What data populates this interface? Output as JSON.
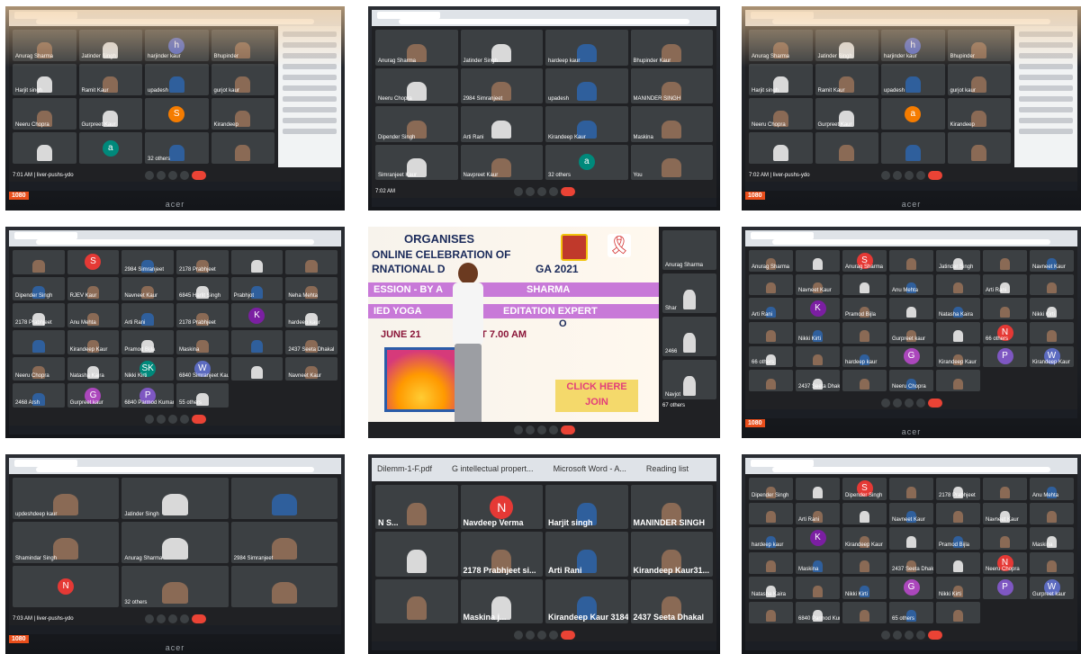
{
  "photos": [
    {
      "id": "p1",
      "meeting_time": "7:01 AM | liver-pushs-ydo",
      "tiles": [
        {
          "label": "Anurag Sharma",
          "kind": "video"
        },
        {
          "label": "Jatinder Singh",
          "kind": "video"
        },
        {
          "label": "harjinder kaur",
          "kind": "avatar",
          "letter": "h",
          "color": "#5c6bc0"
        },
        {
          "label": "Bhupinder",
          "kind": "video"
        },
        {
          "label": "Harjit singh",
          "kind": "video"
        },
        {
          "label": "Ramit Kaur",
          "kind": "video"
        },
        {
          "label": "upadesh",
          "kind": "video"
        },
        {
          "label": "gurjot kaur",
          "kind": "video"
        },
        {
          "label": "Neeru Chopra",
          "kind": "video"
        },
        {
          "label": "Gurpreet Kaur",
          "kind": "video"
        },
        {
          "label": "",
          "kind": "avatar",
          "letter": "S",
          "color": "#f57c00"
        },
        {
          "label": "Kirandeep",
          "kind": "video"
        },
        {
          "label": "",
          "kind": "video"
        },
        {
          "label": "",
          "kind": "avatar",
          "letter": "a",
          "color": "#00897b"
        },
        {
          "label": "32 others",
          "kind": "video"
        },
        {
          "label": "",
          "kind": "video"
        }
      ],
      "sidebar": true,
      "sticker": "1080",
      "brand": "acer"
    },
    {
      "id": "p2",
      "meeting_time": "7:02 AM",
      "tiles": [
        {
          "label": "Anurag Sharma",
          "kind": "video"
        },
        {
          "label": "Jatinder Singh",
          "kind": "video"
        },
        {
          "label": "hardeep kaur",
          "kind": "video"
        },
        {
          "label": "Bhupinder Kaur",
          "kind": "video"
        },
        {
          "label": "Neeru Chopra",
          "kind": "video"
        },
        {
          "label": "2984 Simranjeet",
          "kind": "video"
        },
        {
          "label": "upadesh",
          "kind": "video"
        },
        {
          "label": "MANINDER SINGH",
          "kind": "video"
        },
        {
          "label": "Dipender Singh",
          "kind": "video"
        },
        {
          "label": "Arti Rani",
          "kind": "video"
        },
        {
          "label": "Kirandeep Kaur",
          "kind": "video"
        },
        {
          "label": "Maskina",
          "kind": "video"
        },
        {
          "label": "Simranjeet Kaur",
          "kind": "video"
        },
        {
          "label": "Navpreet Kaur",
          "kind": "video"
        },
        {
          "label": "32 others",
          "kind": "avatar",
          "letter": "a",
          "color": "#00897b"
        },
        {
          "label": "You",
          "kind": "video"
        }
      ],
      "sidebar": false,
      "sticker": "",
      "brand": ""
    },
    {
      "id": "p3",
      "meeting_time": "7:02 AM | liver-pushs-ydo",
      "tiles": [
        {
          "label": "Anurag Sharma",
          "kind": "video"
        },
        {
          "label": "Jatinder Singh",
          "kind": "video"
        },
        {
          "label": "harjinder kaur",
          "kind": "avatar",
          "letter": "h",
          "color": "#5c6bc0"
        },
        {
          "label": "Bhupinder",
          "kind": "video"
        },
        {
          "label": "Harjit singh",
          "kind": "video"
        },
        {
          "label": "Ramit Kaur",
          "kind": "video"
        },
        {
          "label": "upadesh",
          "kind": "video"
        },
        {
          "label": "gurjot kaur",
          "kind": "video"
        },
        {
          "label": "Neeru Chopra",
          "kind": "video"
        },
        {
          "label": "Gurpreet Kaur",
          "kind": "video"
        },
        {
          "label": "",
          "kind": "avatar",
          "letter": "a",
          "color": "#f57c00"
        },
        {
          "label": "Kirandeep",
          "kind": "video"
        },
        {
          "label": "",
          "kind": "video"
        },
        {
          "label": "",
          "kind": "video"
        },
        {
          "label": "",
          "kind": "video"
        },
        {
          "label": "",
          "kind": "video"
        }
      ],
      "sidebar": true,
      "sticker": "1080",
      "brand": "acer"
    },
    {
      "id": "p4",
      "meeting_time": "",
      "tiles": [
        {
          "label": "",
          "kind": "video"
        },
        {
          "label": "",
          "kind": "avatar",
          "letter": "S",
          "color": "#e53935"
        },
        {
          "label": "2984 Simranjeet",
          "kind": "video"
        },
        {
          "label": "2178 Prabhjeet",
          "kind": "video"
        },
        {
          "label": "",
          "kind": "video"
        },
        {
          "label": "",
          "kind": "video"
        },
        {
          "label": "Dipender Singh",
          "kind": "video"
        },
        {
          "label": "RJEV Kaur",
          "kind": "video"
        },
        {
          "label": "Navneet Kaur",
          "kind": "video"
        },
        {
          "label": "6845 Harlit Singh",
          "kind": "video"
        },
        {
          "label": "Prabhjot",
          "kind": "video"
        },
        {
          "label": "Neha Mehta",
          "kind": "video"
        },
        {
          "label": "2178 Prabhjeet",
          "kind": "video"
        },
        {
          "label": "Anu Mehta",
          "kind": "video"
        },
        {
          "label": "Arti Rani",
          "kind": "video"
        },
        {
          "label": "2178 Prabhjeet",
          "kind": "video"
        },
        {
          "label": "",
          "kind": "avatar",
          "letter": "K",
          "color": "#7b1fa2"
        },
        {
          "label": "hardeep kaur",
          "kind": "video"
        },
        {
          "label": "",
          "kind": "video"
        },
        {
          "label": "Kirandeep Kaur",
          "kind": "video"
        },
        {
          "label": "Pramod Bijla",
          "kind": "video"
        },
        {
          "label": "Maskina",
          "kind": "video"
        },
        {
          "label": "",
          "kind": "video"
        },
        {
          "label": "2437 Seeta Dhakal",
          "kind": "video"
        },
        {
          "label": "Neeru Chopra",
          "kind": "video"
        },
        {
          "label": "Natasha Kaira",
          "kind": "video"
        },
        {
          "label": "Nikki Kirti",
          "kind": "avatar",
          "letter": "SK",
          "color": "#00897b"
        },
        {
          "label": "6840 Simranjeet Kaur",
          "kind": "avatar",
          "letter": "W",
          "color": "#5c6bc0"
        },
        {
          "label": "",
          "kind": "video"
        },
        {
          "label": "Navneet Kaur",
          "kind": "video"
        },
        {
          "label": "2468 Arsh",
          "kind": "video"
        },
        {
          "label": "Gurpreet kaur",
          "kind": "avatar",
          "letter": "G",
          "color": "#ab47bc"
        },
        {
          "label": "6840 Parmod Kumar",
          "kind": "avatar",
          "letter": "P",
          "color": "#7e57c2"
        },
        {
          "label": "55 others",
          "kind": "video"
        }
      ],
      "sidebar": false,
      "sticker": "",
      "brand": ""
    },
    {
      "id": "p5",
      "poster": {
        "line1": "ORGANISES",
        "line2": "ONLINE CELEBRATION OF",
        "line3": "RNATIONAL D",
        "line3b": "GA 2021",
        "band1": "ESSION - BY A",
        "band1b": "SHARMA",
        "band2": "IED YOGA",
        "band2b": "EDITATION EXPERT",
        "june": "JUNE  21",
        "june2": "AT    7.00 AM",
        "click": "CLICK HERE",
        "click2": "JOIN",
        "o": "O",
        "self_label": "Anurag Sharma",
        "others": "67 others",
        "side_labels": [
          "Shar",
          "2466",
          "Navjot"
        ]
      }
    },
    {
      "id": "p6",
      "meeting_time": "",
      "tiles_count": 40,
      "labels": [
        "Anurag Sharma",
        "Jatinder Singh",
        "Navneet Kaur",
        "Anu Mehta",
        "Arti Rani",
        "Pramod Bijla",
        "Natasha Kaira",
        "Nikki Kirti",
        "Gurpreet kaur",
        "66 others",
        "hardeep kaur",
        "Kirandeep Kaur",
        "2437 Seeta Dhakal",
        "Neeru Chopra"
      ],
      "sticker": "1080",
      "brand": "acer"
    },
    {
      "id": "p7",
      "meeting_time": "7:03 AM | liver-pushs-ydo",
      "tiles": [
        {
          "label": "updeshdeep kaur",
          "kind": "video"
        },
        {
          "label": "Jatinder Singh",
          "kind": "video"
        },
        {
          "label": "",
          "kind": "video"
        },
        {
          "label": "Shamindar Singh",
          "kind": "video"
        },
        {
          "label": "Anurag Sharma",
          "kind": "video"
        },
        {
          "label": "2984 Simranjeet",
          "kind": "video"
        },
        {
          "label": "",
          "kind": "avatar",
          "letter": "N",
          "color": "#e53935"
        },
        {
          "label": "32 others",
          "kind": "video"
        },
        {
          "label": "",
          "kind": "video"
        }
      ],
      "sidebar": false,
      "sticker": "1080",
      "brand": "acer"
    },
    {
      "id": "p8",
      "bookmarks": [
        "Dilemm-1-F.pdf",
        "G  intellectual propert...",
        "Microsoft Word - A...",
        "Reading list"
      ],
      "tiles": [
        {
          "label": "N S...",
          "kind": "video"
        },
        {
          "label": "Navdeep Verma",
          "kind": "avatar",
          "letter": "N",
          "color": "#e53935"
        },
        {
          "label": "Harjit singh",
          "kind": "video"
        },
        {
          "label": "MANINDER SINGH",
          "kind": "video"
        },
        {
          "label": "",
          "kind": "video"
        },
        {
          "label": "2178 Prabhjeet si...",
          "kind": "video"
        },
        {
          "label": "Arti Rani",
          "kind": "video"
        },
        {
          "label": "Kirandeep Kaur31...",
          "kind": "video"
        },
        {
          "label": "",
          "kind": "video"
        },
        {
          "label": "Maskina j...",
          "kind": "video"
        },
        {
          "label": "Kirandeep Kaur 3184",
          "kind": "video"
        },
        {
          "label": "2437 Seeta Dhakal",
          "kind": "video"
        }
      ]
    },
    {
      "id": "p9",
      "labels": [
        "Dipender Singh",
        "2178 Prabhjeet",
        "Anu Mehta",
        "Arti Rani",
        "Navneet Kaur",
        "hardeep kaur",
        "Kirandeep Kaur",
        "Pramod Bijla",
        "Maskina",
        "2437 Seeta Dhakal",
        "Neeru Chopra",
        "Natasha Kaira",
        "Nikki Kirti",
        "Gurpreet kaur",
        "6840 Parmod Kumar",
        "65 others"
      ],
      "tiles_count": 40,
      "sticker": "",
      "brand": ""
    }
  ]
}
